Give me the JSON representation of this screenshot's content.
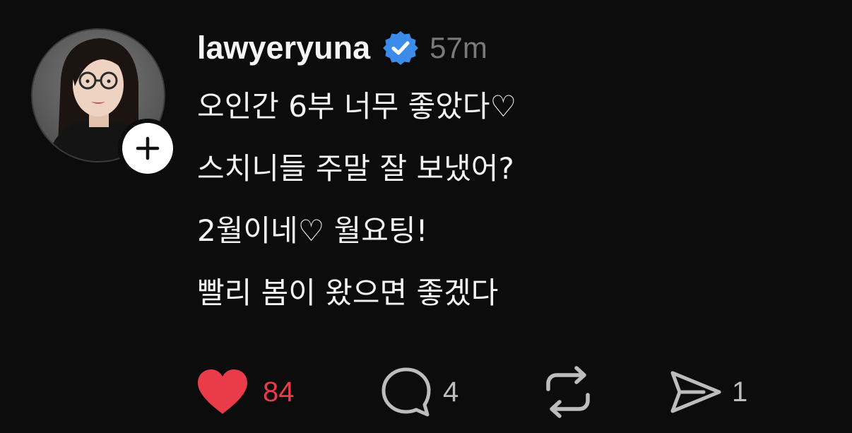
{
  "post": {
    "username": "lawyeryuna",
    "timestamp": "57m",
    "lines": [
      "오인간 6부 너무 좋았다♡",
      "스치니들 주말 잘 보냈어?",
      "2월이네♡ 월요팅!",
      "빨리 봄이 왔으면 좋겠다"
    ]
  },
  "actions": {
    "like": {
      "icon": "heart-icon",
      "count": "84",
      "liked": true,
      "color": "#ea3b4a"
    },
    "reply": {
      "icon": "comment-icon",
      "count": "4"
    },
    "repost": {
      "icon": "repost-icon",
      "count": ""
    },
    "share": {
      "icon": "send-icon",
      "count": "1"
    }
  },
  "colors": {
    "background": "#0c0c0c",
    "text": "#f5f5f5",
    "timestamp": "#7a7a7a",
    "verified": "#3b8beb",
    "like": "#ea3b4a"
  }
}
